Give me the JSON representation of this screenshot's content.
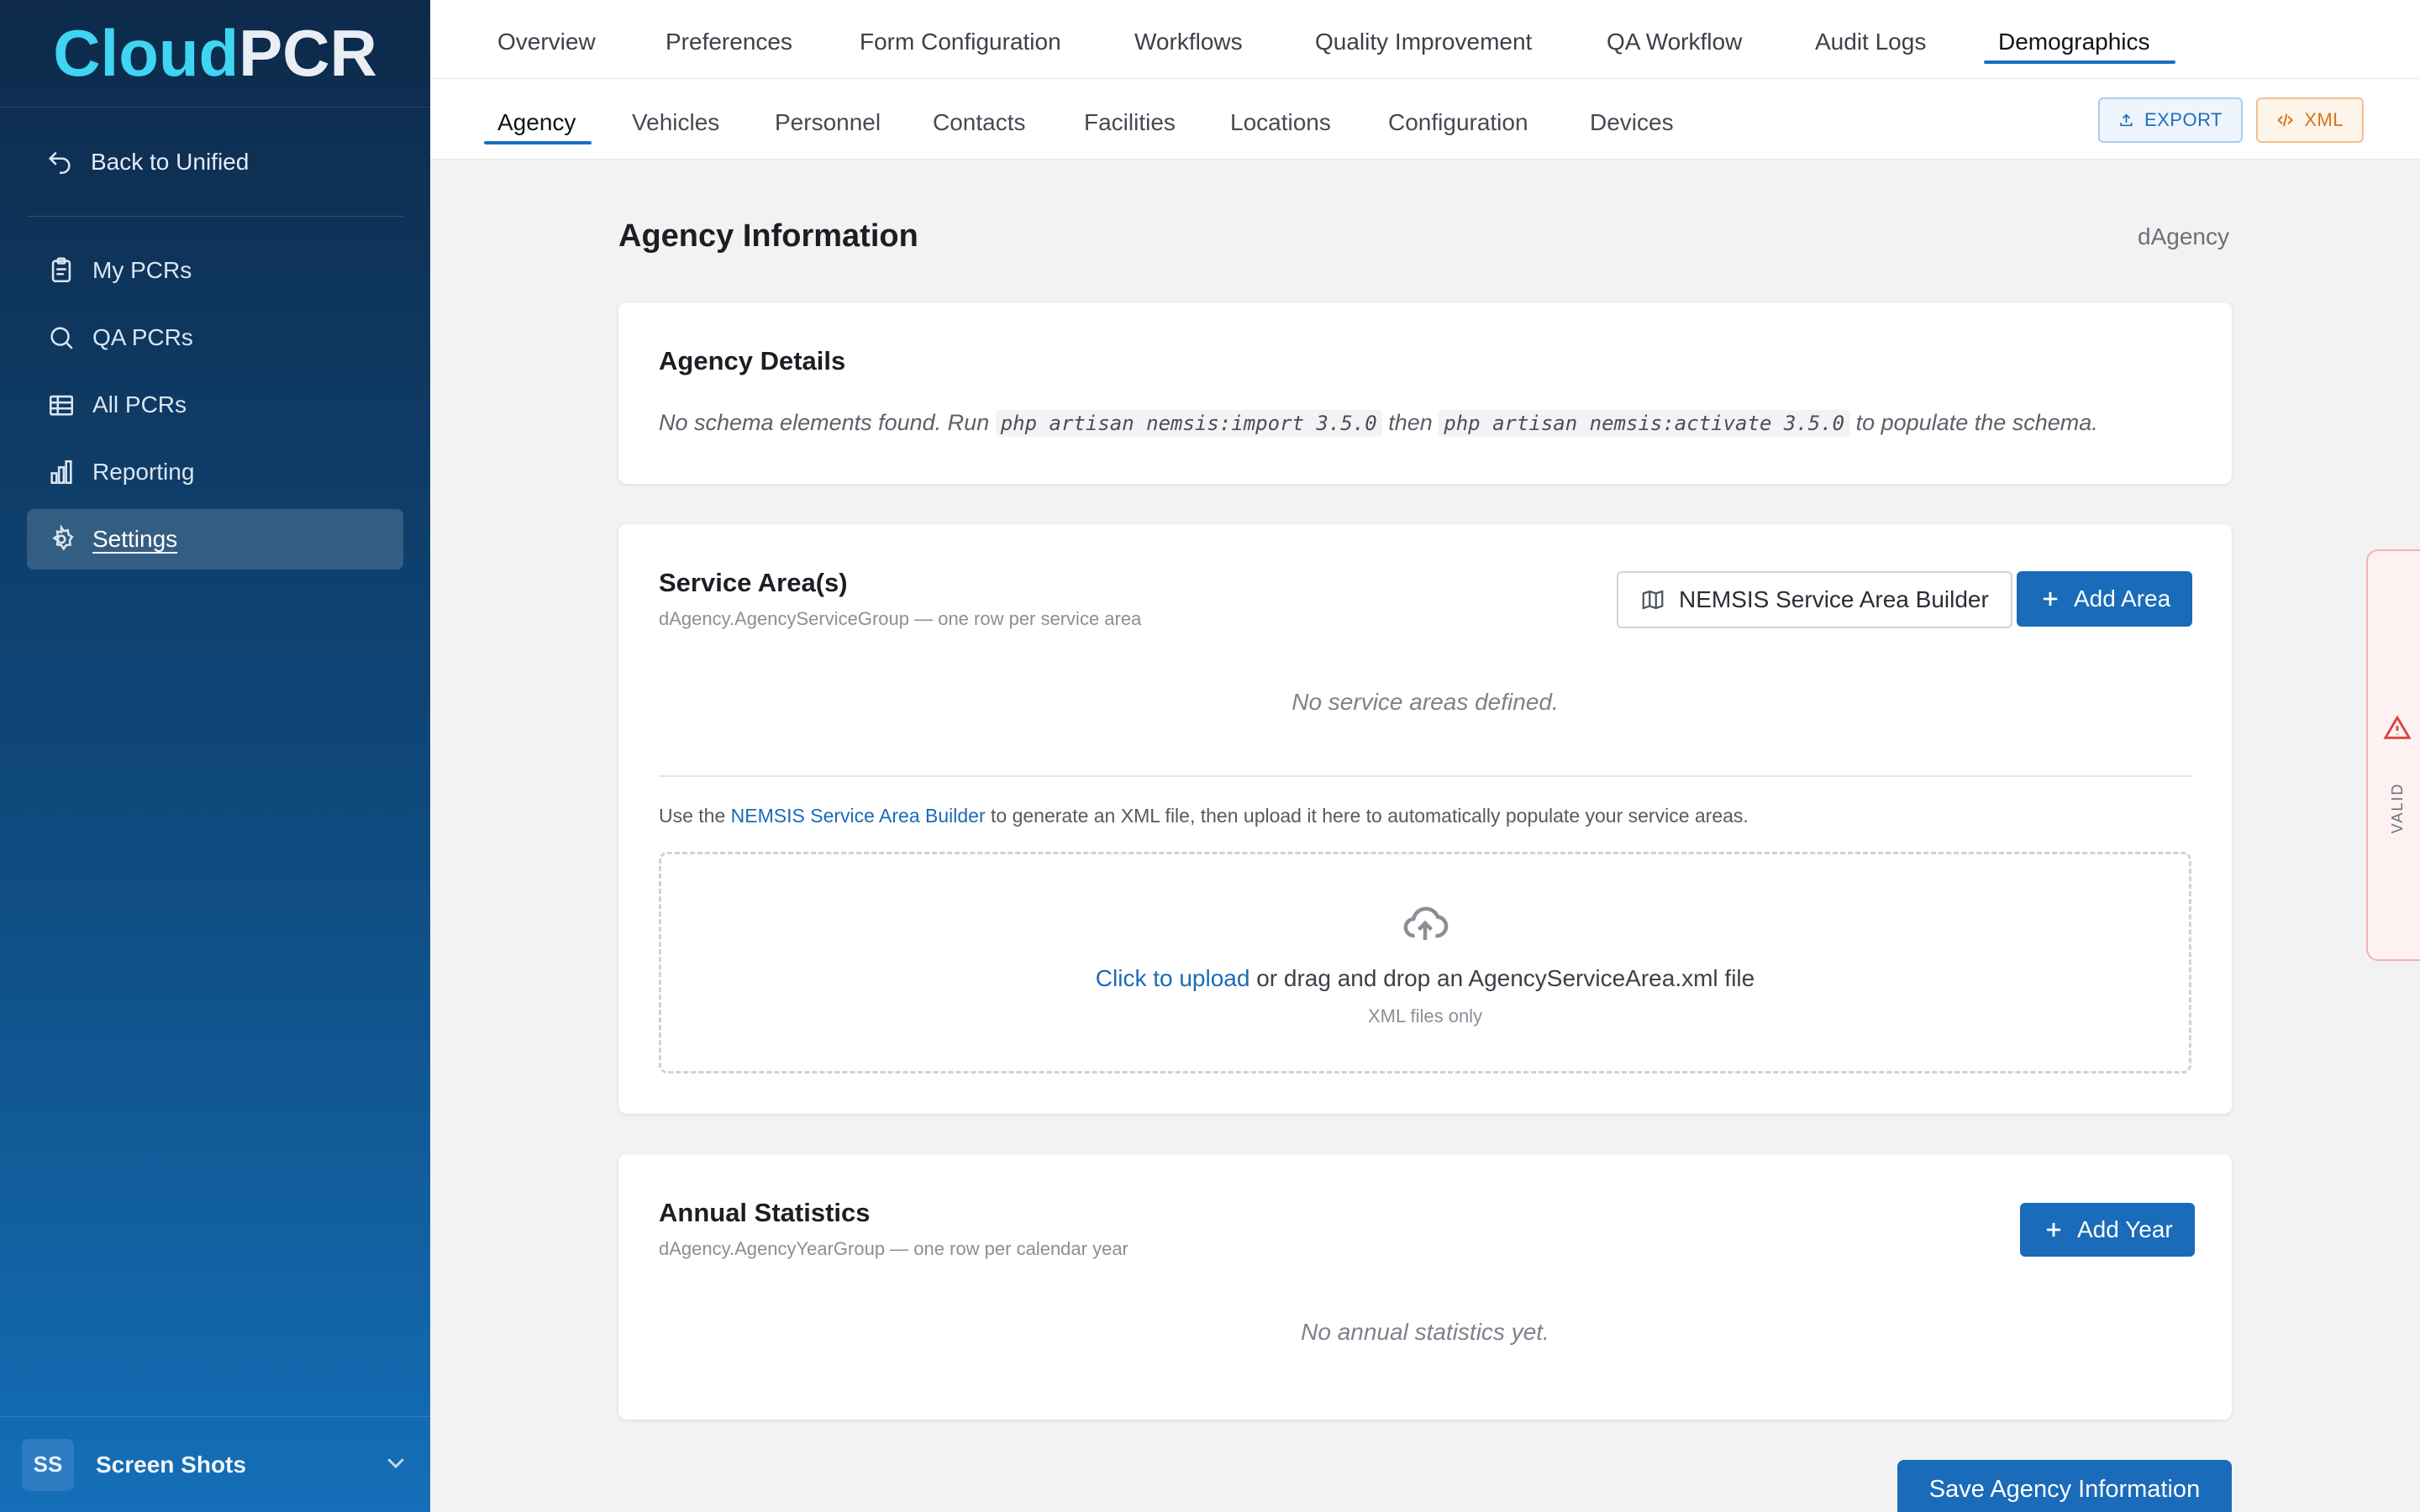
{
  "app": {
    "logo_part1": "Cloud",
    "logo_part2": "PCR"
  },
  "sidebar": {
    "back_label": "Back to Unified",
    "items": [
      {
        "label": "My PCRs",
        "icon": "clipboard-icon"
      },
      {
        "label": "QA PCRs",
        "icon": "search-icon"
      },
      {
        "label": "All PCRs",
        "icon": "table-icon"
      },
      {
        "label": "Reporting",
        "icon": "bar-chart-icon"
      },
      {
        "label": "Settings",
        "icon": "gear-icon",
        "active": true
      }
    ],
    "user": {
      "initials": "SS",
      "name": "Screen Shots"
    }
  },
  "topnav": {
    "tabs": [
      "Overview",
      "Preferences",
      "Form Configuration",
      "Workflows",
      "Quality Improvement",
      "QA Workflow",
      "Audit Logs",
      "Demographics"
    ],
    "active": "Demographics"
  },
  "subnav": {
    "tabs": [
      "Agency",
      "Vehicles",
      "Personnel",
      "Contacts",
      "Facilities",
      "Locations",
      "Configuration",
      "Devices"
    ],
    "active": "Agency",
    "export_label": "EXPORT",
    "xml_label": "XML"
  },
  "page": {
    "title": "Agency Information",
    "tag": "dAgency"
  },
  "agency_details": {
    "title": "Agency Details",
    "msg_part1": "No schema elements found. Run",
    "cmd1": "php artisan nemsis:import 3.5.0",
    "msg_part2": "then",
    "cmd2": "php artisan nemsis:activate 3.5.0",
    "msg_part3": "to populate the schema."
  },
  "service_areas": {
    "title": "Service Area(s)",
    "subtitle": "dAgency.AgencyServiceGroup — one row per service area",
    "builder_button": "NEMSIS Service Area Builder",
    "add_button": "Add Area",
    "empty": "No service areas defined.",
    "help_part1": "Use the",
    "help_link": "NEMSIS Service Area Builder",
    "help_part2": "to generate an XML file, then upload it here to automatically populate your service areas.",
    "upload_link": "Click to upload",
    "upload_text": "or drag and drop an AgencyServiceArea.xml file",
    "upload_hint": "XML files only"
  },
  "annual_stats": {
    "title": "Annual Statistics",
    "subtitle": "dAgency.AgencyYearGroup — one row per calendar year",
    "add_button": "Add Year",
    "empty": "No annual statistics yet."
  },
  "save_button": "Save Agency Information",
  "validation_tab": {
    "label": "VALID",
    "icon": "warning-icon"
  },
  "colors": {
    "primary": "#1a6bb9",
    "logo_accent": "#3fd4f2",
    "export_accent": "#d9731a",
    "validation": "#d6453d"
  }
}
